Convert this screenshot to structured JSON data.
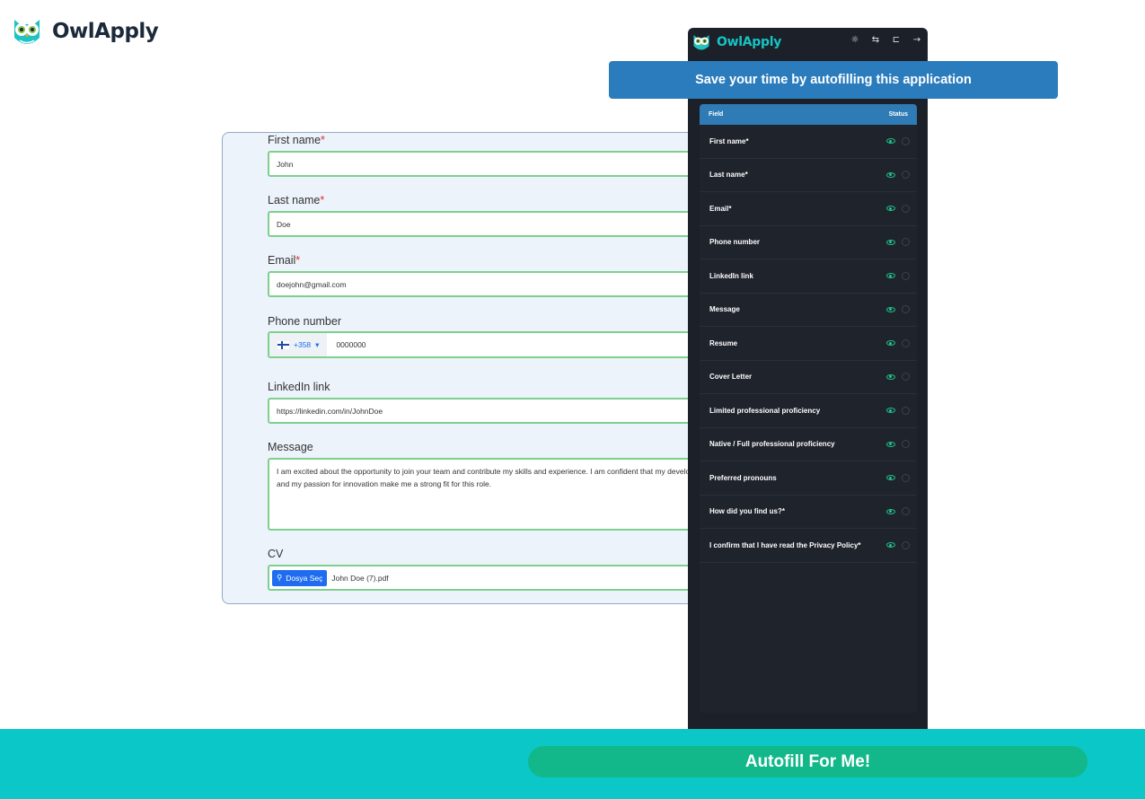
{
  "brand": {
    "name": "OwlApply"
  },
  "form": {
    "fields": [
      {
        "label": "First name",
        "required": true,
        "value": "John"
      },
      {
        "label": "Last name",
        "required": true,
        "value": "Doe"
      },
      {
        "label": "Email",
        "required": true,
        "value": "doejohn@gmail.com"
      },
      {
        "label": "Phone number",
        "required": false,
        "country_code": "+358",
        "value": "0000000"
      },
      {
        "label": "LinkedIn link",
        "required": false,
        "value": "https://linkedin.com/in/JohnDoe"
      },
      {
        "label": "Message",
        "required": false,
        "value": "I am excited about the opportunity to join your team and contribute my skills and experience. I am confident that my development and my passion for innovation make me a strong fit for this role."
      },
      {
        "label": "CV",
        "required": false,
        "button_label": "Dosya Seç",
        "file_name": "John Doe (7).pdf"
      }
    ],
    "required_mark": "*"
  },
  "extension": {
    "title": "OwlApply",
    "header_icons": [
      "sun-icon",
      "swap-icon",
      "dock-icon",
      "arrow-right-icon"
    ],
    "table": {
      "col_field": "Field",
      "col_status": "Status",
      "rows": [
        "First name*",
        "Last name*",
        "Email*",
        "Phone number",
        "LinkedIn link",
        "Message",
        "Resume",
        "Cover Letter",
        "Limited professional proficiency",
        "Native / Full professional proficiency",
        "Preferred pronouns",
        "How did you find us?*",
        "I confirm that I have read the Privacy Policy*"
      ]
    },
    "nav_icons": [
      "home-icon",
      "clipboard-icon",
      "mail-icon",
      "chat-icon",
      "user-icon"
    ],
    "active_nav": "clipboard-icon"
  },
  "banner": {
    "text": "Save your time by autofilling this application"
  },
  "cta": {
    "label": "Autofill For Me!"
  },
  "colors": {
    "accent": "#0bc7c7",
    "button": "#12b88a",
    "banner": "#2b7cbd",
    "panel": "#1c2029",
    "field_border": "#7fcf8f"
  }
}
